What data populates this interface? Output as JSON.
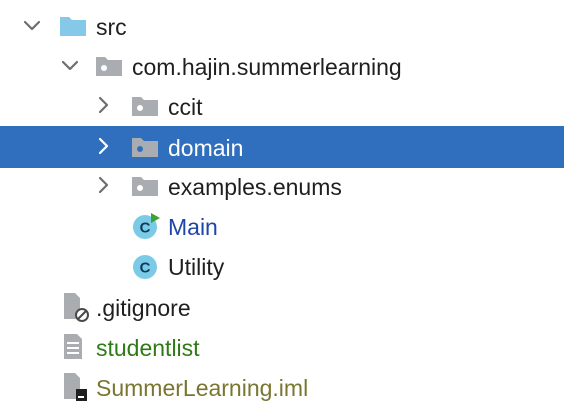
{
  "tree": {
    "rows": [
      {
        "label": "src",
        "icon": "source-folder-icon",
        "toggle": "expanded"
      },
      {
        "label": "com.hajin.summerlearning",
        "icon": "package-icon",
        "toggle": "expanded"
      },
      {
        "label": "ccit",
        "icon": "package-icon",
        "toggle": "collapsed"
      },
      {
        "label": "domain",
        "icon": "package-icon",
        "toggle": "collapsed",
        "selected": true
      },
      {
        "label": "examples.enums",
        "icon": "package-icon",
        "toggle": "collapsed"
      },
      {
        "label": "Main",
        "icon": "runnable-class-icon",
        "class_letter": "C"
      },
      {
        "label": "Utility",
        "icon": "class-icon",
        "class_letter": "C"
      },
      {
        "label": ".gitignore",
        "icon": "ignored-file-icon"
      },
      {
        "label": "studentlist",
        "icon": "text-file-icon"
      },
      {
        "label": "SummerLearning.iml",
        "icon": "module-file-icon"
      }
    ]
  },
  "colors": {
    "selection": "#2f6fbd",
    "class_icon": "#7ccbe6",
    "run_marker": "#3aa335",
    "folder_source": "#86c8e8",
    "folder_package": "#a9adb2",
    "class_text": "#1e46a8",
    "untracked_text": "#2d7a16",
    "modified_text": "#7a7630"
  }
}
